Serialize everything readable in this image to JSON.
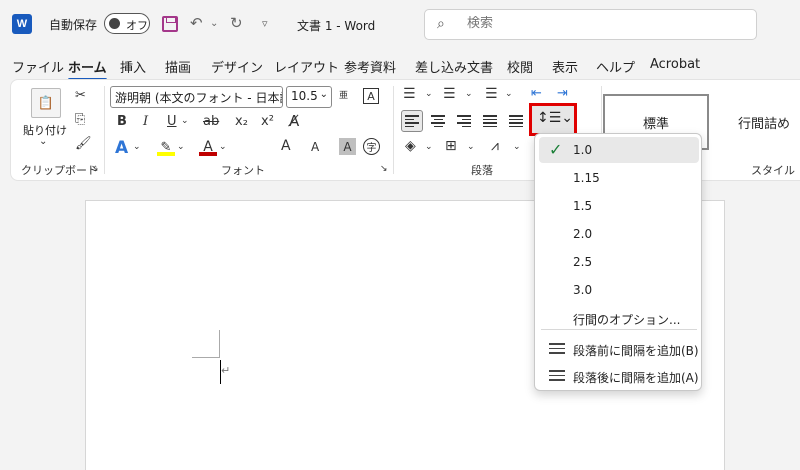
{
  "titlebar": {
    "logo": "W",
    "autosave_label": "自動保存",
    "autosave_state": "オフ",
    "doc_title": "文書 1  -  Word",
    "search_placeholder": "検索"
  },
  "tabs": [
    "ファイル",
    "ホーム",
    "挿入",
    "描画",
    "デザイン",
    "レイアウト",
    "参考資料",
    "差し込み文書",
    "校閲",
    "表示",
    "ヘルプ",
    "Acrobat"
  ],
  "active_tab": "ホーム",
  "ribbon": {
    "clipboard": {
      "paste_label": "貼り付け",
      "group_label": "クリップボード"
    },
    "font": {
      "font_name": "游明朝 (本文のフォント - 日本語)",
      "font_size": "10.5",
      "bold": "B",
      "italic": "I",
      "underline": "U",
      "strike": "ab",
      "subscript": "x₂",
      "superscript": "x²",
      "grow": "A",
      "shrink": "A",
      "group_label": "フォント"
    },
    "paragraph": {
      "group_label": "段落"
    },
    "styles": {
      "normal": "標準",
      "no_spacing": "行間詰め",
      "group_label": "スタイル"
    }
  },
  "line_spacing_dropdown": {
    "items": [
      {
        "label": "1.0",
        "selected": true
      },
      {
        "label": "1.15",
        "selected": false
      },
      {
        "label": "1.5",
        "selected": false
      },
      {
        "label": "2.0",
        "selected": false
      },
      {
        "label": "2.5",
        "selected": false
      },
      {
        "label": "3.0",
        "selected": false
      }
    ],
    "options_label": "行間のオプション...",
    "add_before": "段落前に間隔を追加(B)",
    "add_after": "段落後に間隔を追加(A)"
  },
  "colors": {
    "accent": "#185abd",
    "highlight": "#e00000",
    "font_color": "#c00000",
    "marker": "#ffff00"
  },
  "icons": [
    "word-logo-icon",
    "save-icon",
    "undo-icon",
    "redo-icon",
    "search-icon",
    "check-icon",
    "line-spacing-icon"
  ]
}
